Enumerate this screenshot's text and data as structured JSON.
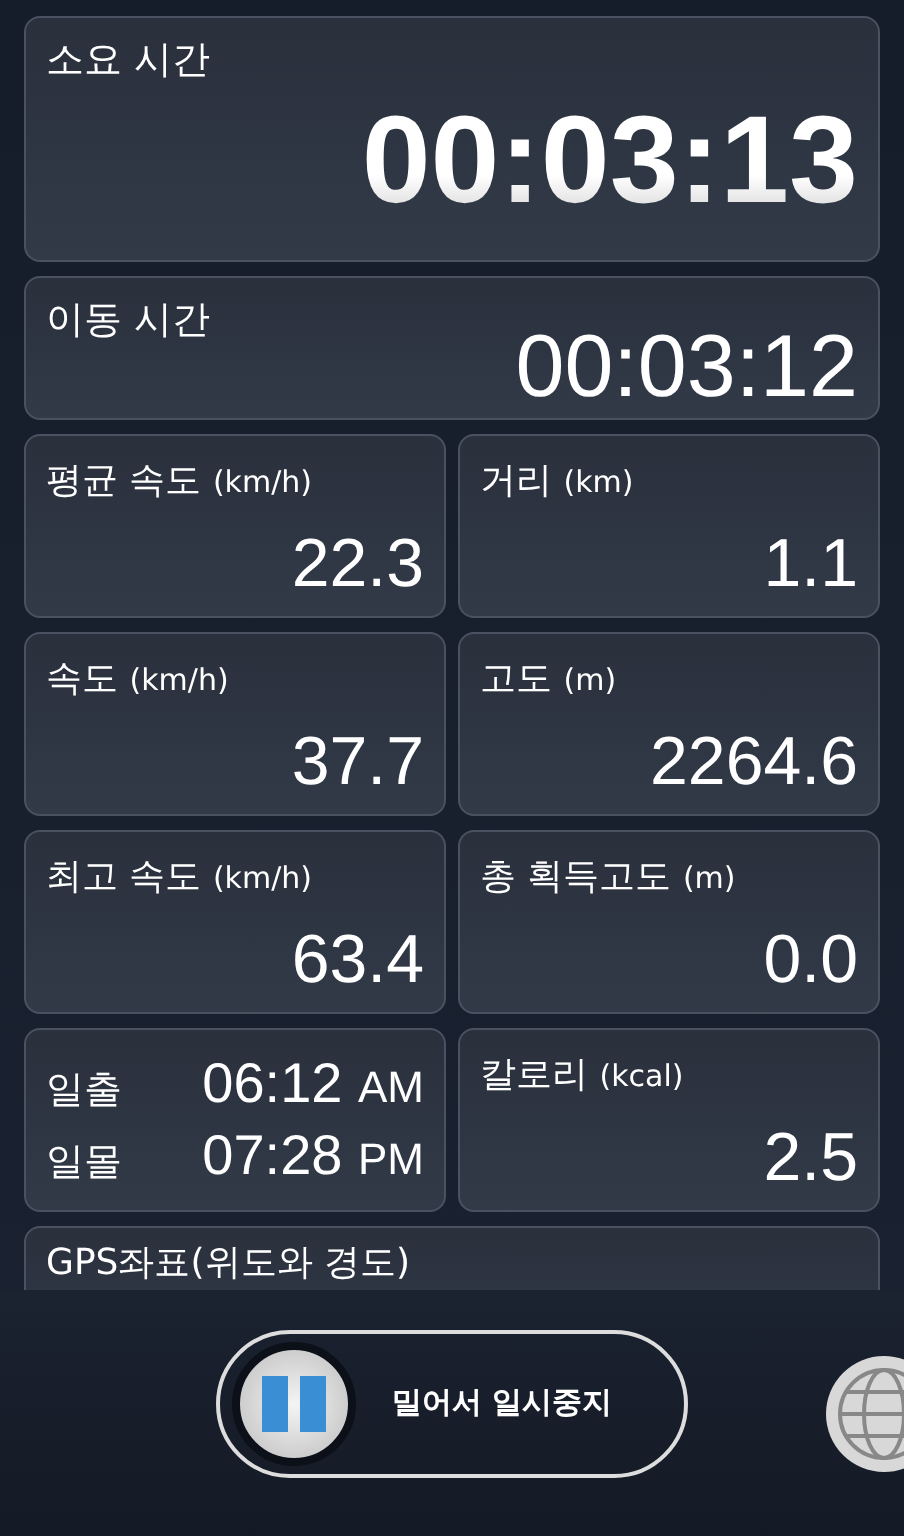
{
  "timers": [
    {
      "label": "소요 시간",
      "value": "00:03:13",
      "kind": "large"
    },
    {
      "label": "이동 시간",
      "value": "00:03:12",
      "kind": "normal"
    }
  ],
  "cells": [
    {
      "kind": "stat",
      "label": "평균 속도",
      "unit": "(km/h)",
      "value": "22.3"
    },
    {
      "kind": "stat",
      "label": "거리",
      "unit": "(km)",
      "value": "1.1"
    },
    {
      "kind": "stat",
      "label": "속도",
      "unit": "(km/h)",
      "value": "37.7"
    },
    {
      "kind": "stat",
      "label": "고도",
      "unit": "(m)",
      "value": "2264.6"
    },
    {
      "kind": "stat",
      "label": "최고 속도",
      "unit": "(km/h)",
      "value": "63.4"
    },
    {
      "kind": "stat",
      "label": "총 획득고도",
      "unit": "(m)",
      "value": "0.0"
    },
    {
      "kind": "sun",
      "rows": [
        {
          "label": "일출",
          "time": "06:12",
          "period": "AM"
        },
        {
          "label": "일몰",
          "time": "07:28",
          "period": "PM"
        }
      ]
    },
    {
      "kind": "stat",
      "label": "칼로리",
      "unit": "(kcal)",
      "value": "2.5"
    }
  ],
  "gps": {
    "label": "GPS좌표(위도와 경도)"
  },
  "slider": {
    "label": "밀어서 일시중지",
    "level": 0
  }
}
